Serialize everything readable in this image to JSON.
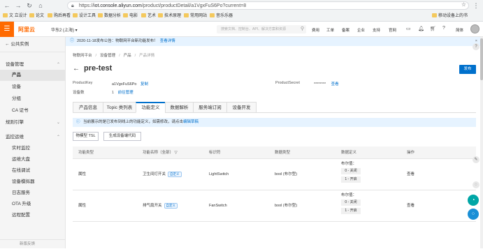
{
  "browser": {
    "url_prefix": "https://",
    "url_domain": "iot.console.aliyun.com",
    "url_path": "/product/productDetail/a1VgxFuS6Po?current=8",
    "bookmarks": [
      "文 立设计",
      "论文",
      "购后再看",
      "设计工具",
      "数据分析",
      "电影",
      "艺术",
      "技术原理",
      "常用网站",
      "音乐乐器"
    ],
    "bookmarks_right": "移动设备上的书"
  },
  "header": {
    "logo": "阿里云",
    "region": "华东2 (上海)",
    "search_placeholder": "搜索文档、控制台、API、解决方案和资源",
    "links": [
      "费用",
      "工单",
      "备案",
      "企业",
      "支持",
      "官网"
    ],
    "lang": "简体"
  },
  "sidebar": {
    "back": "公共实例",
    "items": [
      {
        "label": "设备管理",
        "kind": "grp",
        "chev": "⌃"
      },
      {
        "label": "产品",
        "kind": "sub",
        "active": true
      },
      {
        "label": "设备",
        "kind": "sub"
      },
      {
        "label": "分组",
        "kind": "sub"
      },
      {
        "label": "CA 证书",
        "kind": "sub"
      },
      {
        "label": "规则引擎",
        "kind": "grp",
        "chev": "⌄"
      },
      {
        "label": "监控运维",
        "kind": "grp",
        "chev": "⌃"
      },
      {
        "label": "实时监控",
        "kind": "sub"
      },
      {
        "label": "运维大盘",
        "kind": "sub"
      },
      {
        "label": "在线调试",
        "kind": "sub"
      },
      {
        "label": "设备模拟器",
        "kind": "sub"
      },
      {
        "label": "日志服务",
        "kind": "sub"
      },
      {
        "label": "OTA 升级",
        "kind": "sub"
      },
      {
        "label": "远程配置",
        "kind": "sub"
      }
    ],
    "footer": "新版反馈"
  },
  "main": {
    "notice": "2020-11-18发布公告：物联网平台新功能发布！",
    "notice_link": "查看详情",
    "breadcrumb": [
      "物联网平台",
      "设备管理",
      "产品",
      "产品详情"
    ],
    "title": "pre-test",
    "publish": "发布",
    "meta": {
      "product_key_label": "ProductKey",
      "product_key": "a1VgxFuS6Po",
      "copy": "复制",
      "product_secret_label": "ProductSecret",
      "product_secret": "********",
      "view": "查看",
      "device_count_label": "设备数",
      "device_count": "1",
      "manage": "前往管理"
    },
    "tabs": [
      "产品信息",
      "Topic 类列表",
      "功能定义",
      "数据解析",
      "服务端订阅",
      "设备开发"
    ],
    "info": "当前展示的是已发布到线上的功能定义，如需修改，请点击",
    "info_link": "编辑草稿",
    "buttons": [
      "物模型 TSL",
      "生成设备端代码"
    ],
    "columns": [
      "功能类型",
      "功能名称（全部）",
      "标识符",
      "数据类型",
      "数据定义",
      "操作"
    ],
    "rows": [
      {
        "type": "属性",
        "name": "卫生间灯开关",
        "tag": "自定义",
        "id": "LightSwitch",
        "dtype": "bool (布尔型)",
        "def_label": "布尔值：",
        "enum": [
          "0 - 关闭",
          "1 - 开启"
        ],
        "op": "查看"
      },
      {
        "type": "属性",
        "name": "排气扇开关",
        "tag": "自定义",
        "id": "FanSwitch",
        "dtype": "bool (布尔型)",
        "def_label": "布尔值：",
        "enum": [
          "0 - 关闭",
          "1 - 开启"
        ],
        "op": "查看"
      }
    ]
  }
}
